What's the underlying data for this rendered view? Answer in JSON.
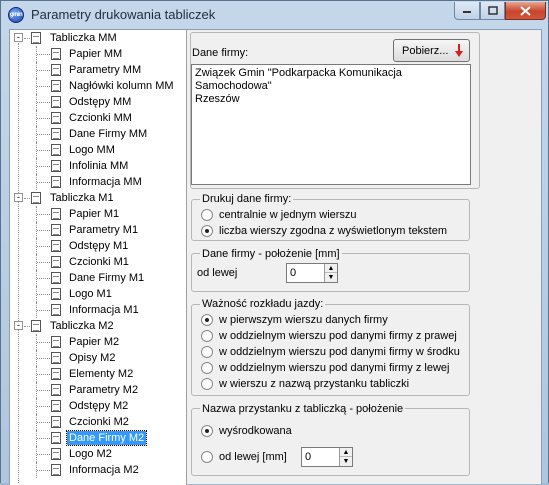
{
  "window": {
    "title": "Parametry drukowania tabliczek",
    "app_icon_text": "gmin"
  },
  "tree": {
    "items": [
      {
        "label": "Tabliczka MM",
        "level": 0,
        "expander": "-"
      },
      {
        "label": "Papier MM",
        "level": 1
      },
      {
        "label": "Parametry MM",
        "level": 1
      },
      {
        "label": "Nagłówki kolumn MM",
        "level": 1
      },
      {
        "label": "Odstępy MM",
        "level": 1
      },
      {
        "label": "Czcionki MM",
        "level": 1
      },
      {
        "label": "Dane Firmy MM",
        "level": 1
      },
      {
        "label": "Logo MM",
        "level": 1
      },
      {
        "label": "Infolinia MM",
        "level": 1
      },
      {
        "label": "Informacja MM",
        "level": 1
      },
      {
        "label": "Tabliczka M1",
        "level": 0,
        "expander": "-"
      },
      {
        "label": "Papier M1",
        "level": 1
      },
      {
        "label": "Parametry M1",
        "level": 1
      },
      {
        "label": "Odstępy M1",
        "level": 1
      },
      {
        "label": "Czcionki M1",
        "level": 1
      },
      {
        "label": "Dane Firmy M1",
        "level": 1
      },
      {
        "label": "Logo M1",
        "level": 1
      },
      {
        "label": "Informacja M1",
        "level": 1
      },
      {
        "label": "Tabliczka M2",
        "level": 0,
        "expander": "-"
      },
      {
        "label": "Papier M2",
        "level": 1
      },
      {
        "label": "Opisy M2",
        "level": 1
      },
      {
        "label": "Elementy M2",
        "level": 1
      },
      {
        "label": "Parametry M2",
        "level": 1
      },
      {
        "label": "Odstępy M2",
        "level": 1
      },
      {
        "label": "Czcionki M2",
        "level": 1
      },
      {
        "label": "Dane Firmy M2",
        "level": 1,
        "selected": true
      },
      {
        "label": "Logo M2",
        "level": 1
      },
      {
        "label": "Informacja M2",
        "level": 1
      }
    ]
  },
  "company": {
    "section_label": "Dane firmy:",
    "fetch_button": "Pobierz...",
    "text": "Związek Gmin \"Podkarpacka Komunikacja\nSamochodowa\"\nRzeszów"
  },
  "print_data": {
    "title": "Drukuj dane firmy:",
    "options": [
      {
        "label": "centralnie w jednym wierszu",
        "checked": false
      },
      {
        "label": "liczba wierszy zgodna z wyświetlonym tekstem",
        "checked": true
      }
    ]
  },
  "position": {
    "title": "Dane firmy - położenie [mm]",
    "left_label": "od lewej",
    "left_value": "0"
  },
  "validity": {
    "title": "Ważność rozkładu jazdy:",
    "options": [
      {
        "label": "w pierwszym wierszu danych firmy",
        "checked": true
      },
      {
        "label": "w oddzielnym wierszu pod danymi firmy z prawej",
        "checked": false
      },
      {
        "label": "w oddzielnym wierszu pod danymi firmy w środku",
        "checked": false
      },
      {
        "label": "w oddzielnym wierszu pod danymi firmy z lewej",
        "checked": false
      },
      {
        "label": "w wierszu z nazwą przystanku tabliczki",
        "checked": false
      }
    ]
  },
  "stop_name": {
    "title": "Nazwa przystanku z tabliczką  - położenie",
    "options": [
      {
        "label": "wyśrodkowana",
        "checked": true
      },
      {
        "label": "od lewej [mm]",
        "checked": false
      }
    ],
    "left_value": "0"
  },
  "colors": {
    "selection": "#3399ff",
    "arrow": "#d42020"
  }
}
